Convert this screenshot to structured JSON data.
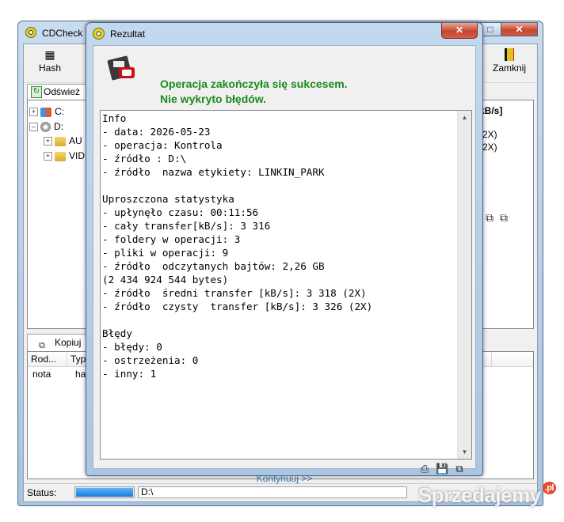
{
  "main_window": {
    "title": "CDCheck -",
    "toolbar": {
      "hash_label": "Hash",
      "close_label": "Zamknij"
    },
    "tab_refresh": "Odśwież",
    "tree": [
      {
        "label": "C:"
      },
      {
        "label": "D:"
      },
      {
        "label": "AU"
      },
      {
        "label": "VID"
      }
    ],
    "right_pane": {
      "header": "kB/s]",
      "rows": [
        "(2X)",
        "(2X)"
      ]
    },
    "copy_tab": "Kopiuj",
    "list": {
      "columns": [
        "Rod...",
        "Typ"
      ],
      "rows": [
        {
          "kind": "nota",
          "type": "has"
        }
      ]
    },
    "status": {
      "label": "Status:",
      "path": "D:\\"
    }
  },
  "dialog": {
    "title": "Rezultat",
    "message_line1": "Operacja zakończyła się sukcesem.",
    "message_line2": "Nie wykryto błędów.",
    "report_lines": [
      "Info",
      "- data: 2026-05-23",
      "- operacja: Kontrola",
      "- źródło : D:\\",
      "- źródło  nazwa etykiety: LINKIN_PARK",
      "",
      "Uproszczona statystyka",
      "- upłynęło czasu: 00:11:56",
      "- cały transfer[kB/s]: 3 316",
      "- foldery w operacji: 3",
      "- pliki w operacji: 9",
      "- źródło  odczytanych bajtów: 2,26 GB",
      "(2 434 924 544 bytes)",
      "- źródło  średni transfer [kB/s]: 3 318 (2X)",
      "- źródło  czysty  transfer [kB/s]: 3 326 (2X)",
      "",
      "Błędy",
      "- błędy: 0",
      "- ostrzeżenia: 0",
      "- inny: 1"
    ],
    "continue_label": "Kontynuuj >>"
  },
  "watermark": {
    "text": "Sprzedajemy",
    "badge": ".pl"
  },
  "colors": {
    "success_green": "#1b8a1b",
    "link_blue": "#3a6ea5",
    "close_red": "#c6452d"
  }
}
